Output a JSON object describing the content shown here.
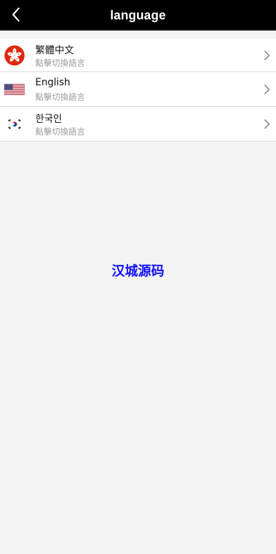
{
  "header": {
    "title": "language",
    "back_icon": "chevron-left-icon"
  },
  "languages": [
    {
      "name": "繁體中文",
      "hint": "點擊切換語言",
      "flag": "hong-kong-flag-icon"
    },
    {
      "name": "English",
      "hint": "點擊切換語言",
      "flag": "us-flag-icon"
    },
    {
      "name": "한국인",
      "hint": "點擊切換語言",
      "flag": "korea-flag-icon"
    }
  ],
  "watermark": "汉城源码",
  "colors": {
    "header_bg": "#000000",
    "page_bg": "#f3f3f3",
    "watermark": "#1010ff",
    "hk_red": "#de2910"
  }
}
